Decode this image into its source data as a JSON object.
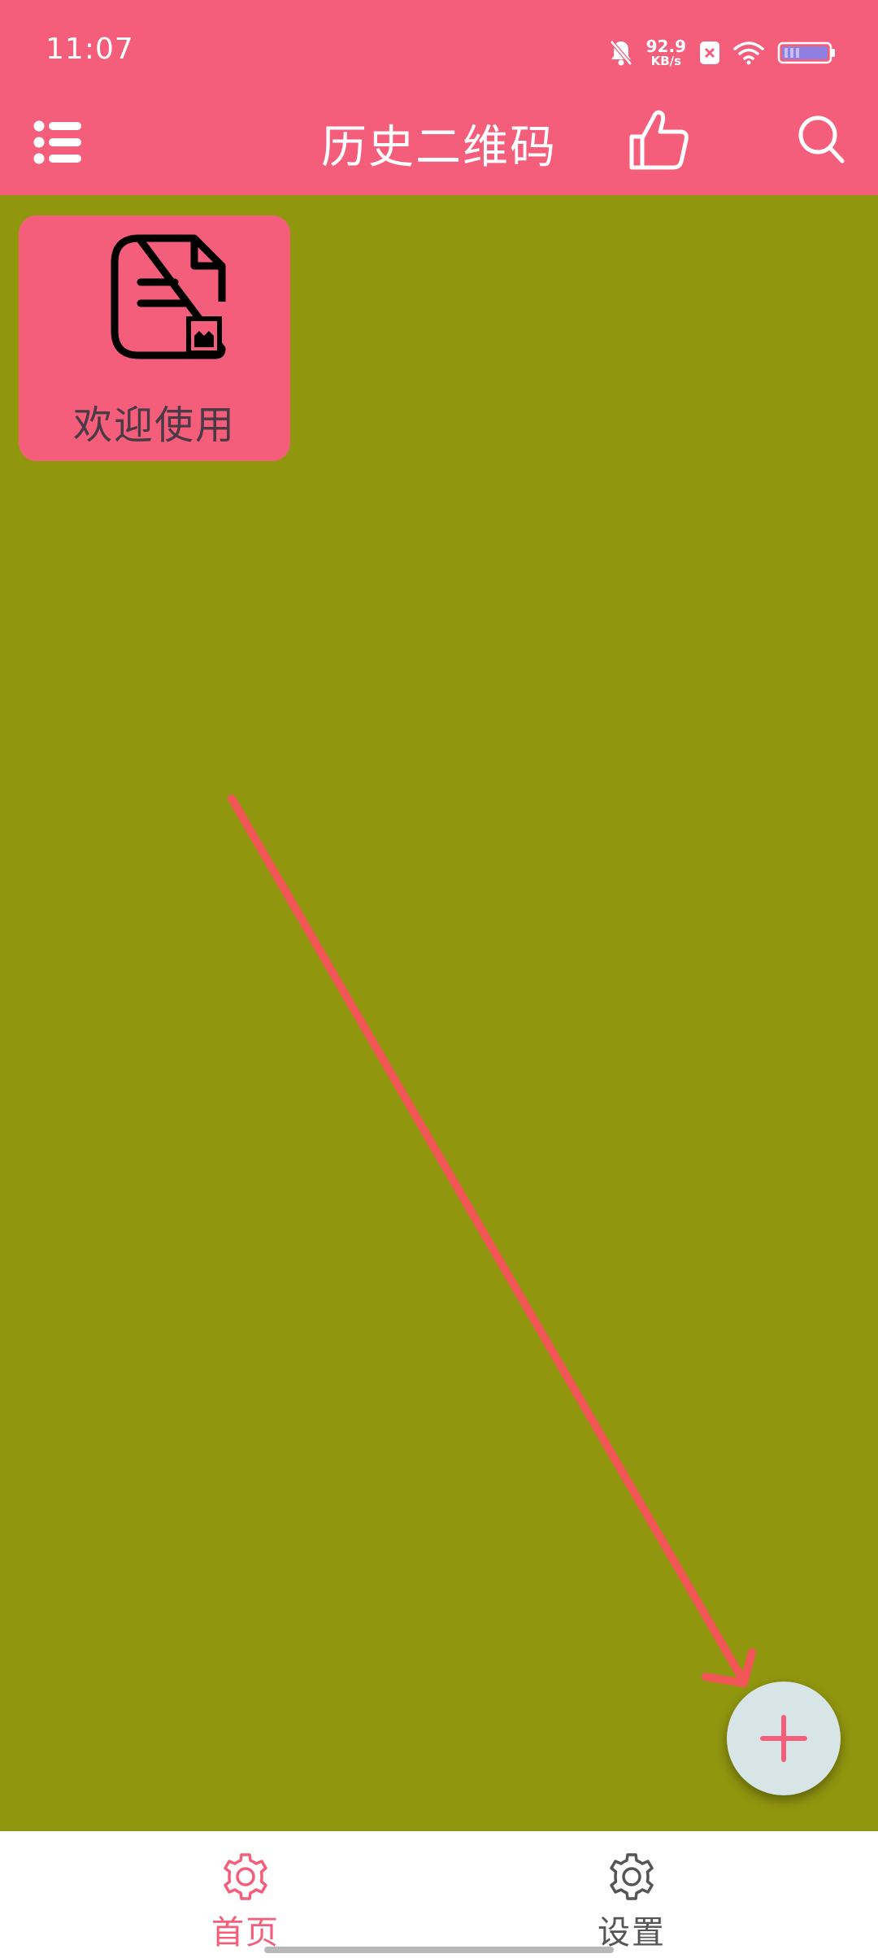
{
  "status_bar": {
    "time": "11:07",
    "net_speed_value": "92.9",
    "net_speed_unit": "KB/s",
    "icons": [
      "mute-bell-icon",
      "x-box-icon",
      "wifi-icon",
      "battery-icon"
    ]
  },
  "app_bar": {
    "title": "历史二维码",
    "icons": [
      "menu-list-icon",
      "thumbs-up-icon",
      "search-icon"
    ]
  },
  "cards": [
    {
      "label": "欢迎使用",
      "icon": "document-icon"
    }
  ],
  "fab": {
    "icon": "plus-icon"
  },
  "bottom_nav": {
    "items": [
      {
        "label": "首页",
        "icon": "gear-icon",
        "active": true
      },
      {
        "label": "设置",
        "icon": "gear-icon",
        "active": false
      }
    ]
  },
  "colors": {
    "primary": "#f55e7b",
    "background": "#91960f",
    "fab_background": "#d8e5e6",
    "arrow": "#f25555",
    "nav_inactive": "#555555"
  }
}
